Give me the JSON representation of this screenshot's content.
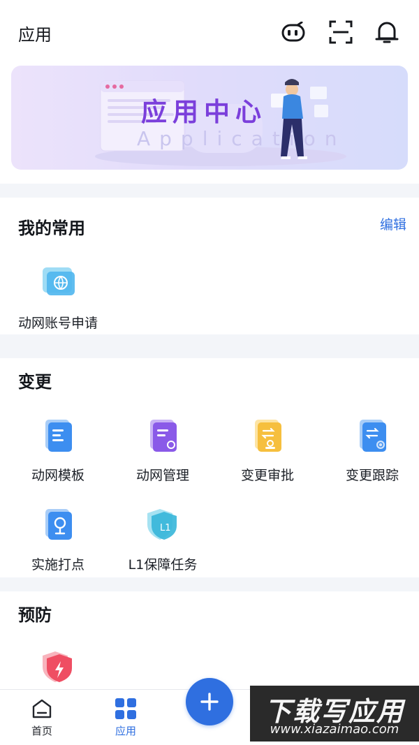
{
  "header": {
    "title": "应用",
    "icons": [
      "robot-face-icon",
      "scan-icon",
      "bell-icon"
    ]
  },
  "banner": {
    "title": "应用中心",
    "subtitle": "Application"
  },
  "favorites": {
    "title": "我的常用",
    "edit_label": "编辑",
    "items": [
      {
        "label": "动网账号申请",
        "icon": "network-account-icon"
      }
    ]
  },
  "change": {
    "title": "变更",
    "items": [
      {
        "label": "动网模板",
        "icon": "template-doc-icon"
      },
      {
        "label": "动网管理",
        "icon": "manage-doc-icon"
      },
      {
        "label": "变更审批",
        "icon": "approval-stamp-icon"
      },
      {
        "label": "变更跟踪",
        "icon": "tracking-icon"
      },
      {
        "label": "实施打点",
        "icon": "map-pin-icon"
      },
      {
        "label": "L1保障任务",
        "icon": "l1-shield-icon"
      }
    ]
  },
  "prevent": {
    "title": "预防",
    "items": [
      {
        "label": "",
        "icon": "lightning-shield-icon"
      }
    ]
  },
  "bottom_nav": {
    "items": [
      {
        "label": "首页",
        "icon": "home-icon",
        "active": false
      },
      {
        "label": "应用",
        "icon": "apps-grid-icon",
        "active": true
      }
    ],
    "fab_icon": "plus-icon"
  },
  "watermark": {
    "title": "下载写应用",
    "url": "www.xiazaimao.com"
  },
  "colors": {
    "accent": "#2f6fe0",
    "banner_title": "#7b3fdb"
  }
}
